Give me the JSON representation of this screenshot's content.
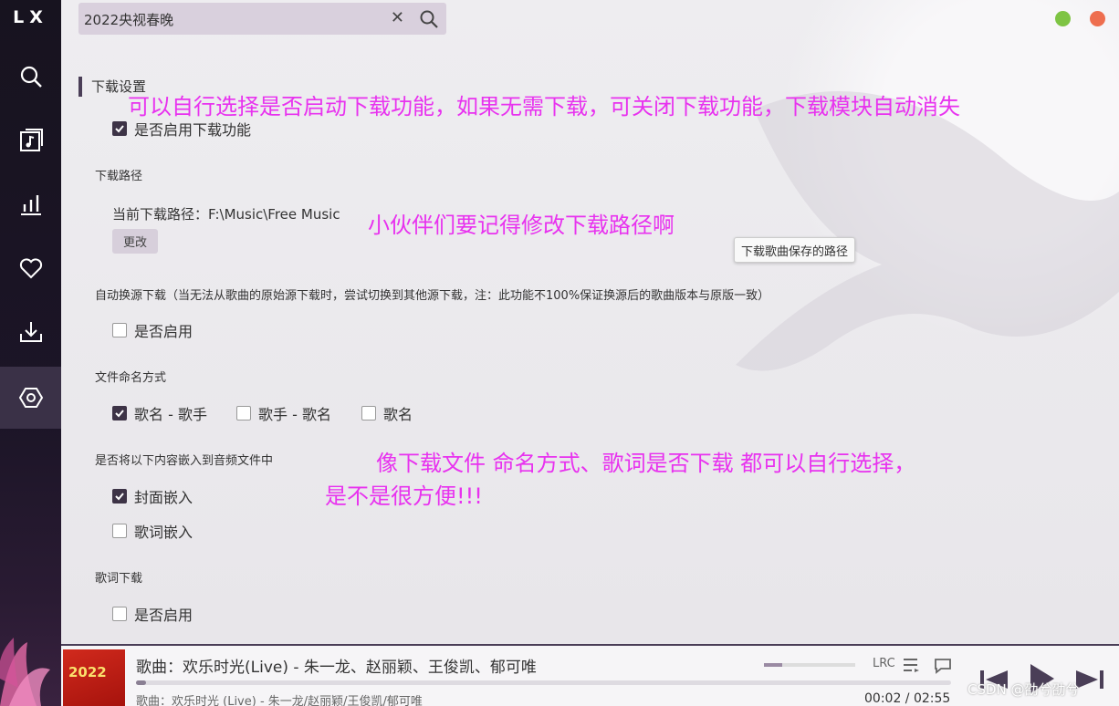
{
  "app": {
    "logo": "LX"
  },
  "search": {
    "value": "2022央视春晚",
    "clear": "✕"
  },
  "settings": {
    "section_title": "下载设置",
    "enable_download": {
      "label": "是否启用下载功能",
      "checked": true
    },
    "path": {
      "heading": "下载路径",
      "current_label": "当前下载路径：F:\\Music\\Free Music",
      "change_button": "更改",
      "tooltip": "下载歌曲保存的路径"
    },
    "auto_switch": {
      "heading": "自动换源下载（当无法从歌曲的原始源下载时，尝试切换到其他源下载，注：此功能不100%保证换源后的歌曲版本与原版一致）",
      "enable_label": "是否启用",
      "checked": false
    },
    "naming": {
      "heading": "文件命名方式",
      "options": [
        {
          "label": "歌名 - 歌手",
          "checked": true
        },
        {
          "label": "歌手 - 歌名",
          "checked": false
        },
        {
          "label": "歌名",
          "checked": false
        }
      ]
    },
    "embed": {
      "heading": "是否将以下内容嵌入到音频文件中",
      "cover_label": "封面嵌入",
      "cover_checked": true,
      "lyrics_label": "歌词嵌入",
      "lyrics_checked": false
    },
    "lyrics_download": {
      "heading": "歌词下载",
      "enable_label": "是否启用",
      "checked": false
    }
  },
  "annotations": {
    "note1": "可以自行选择是否启动下载功能，如果无需下载，可关闭下载功能，下载模块自动消失",
    "note2": "小伙伴们要记得修改下载路径啊",
    "note3_line1": "像下载文件 命名方式、歌词是否下载 都可以自行选择，",
    "note3_line2": "是不是很方便!!!"
  },
  "player": {
    "title": "歌曲：欢乐时光(Live) - 朱一龙、赵丽颖、王俊凯、郁可唯",
    "subtitle": "歌曲：欢乐时光 (Live) - 朱一龙/赵丽颖/王俊凯/郁可唯",
    "time": "00:02 / 02:55",
    "progress": 0.012,
    "volume": 0.2,
    "lrc_label": "LRC",
    "cover_text": "2022"
  },
  "watermark": "CSDN @劭兮劭兮",
  "colors": {
    "accent": "#4a3e57",
    "annotation": "#e832ef",
    "checked": "#3d3346"
  }
}
